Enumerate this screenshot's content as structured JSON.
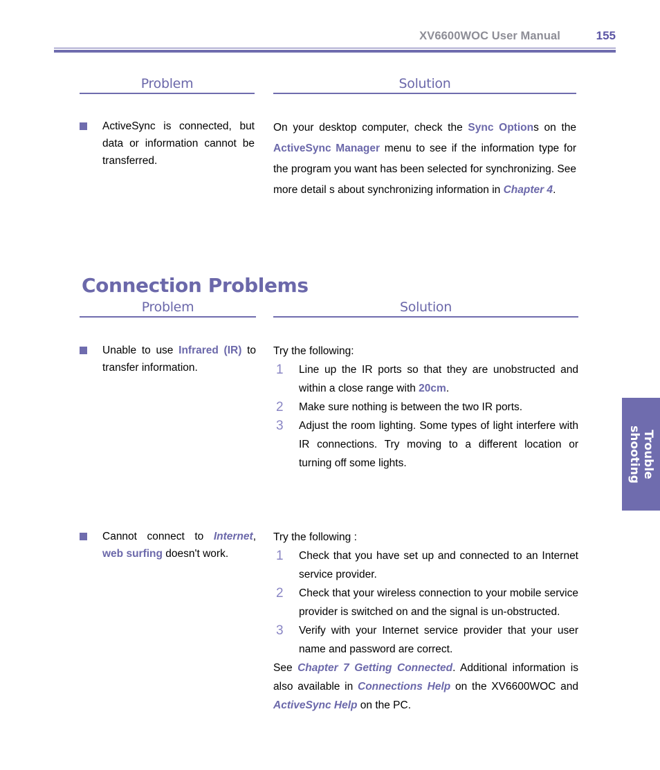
{
  "header": {
    "title": "XV6600WOC User Manual",
    "page_number": "155",
    "rule_color": "#6f6cae",
    "title_color": "#8d8d96",
    "page_number_color": "#5b55a4"
  },
  "accent_color": "#6b68aa",
  "table_headers": {
    "problem": "Problem",
    "solution": "Solution"
  },
  "section": {
    "heading": "Connection Problems"
  },
  "rows": [
    {
      "problem": {
        "pre": "ActiveSync is connected, but data or information cannot be transferred."
      },
      "solution": {
        "paragraph_parts": [
          {
            "type": "text",
            "value": "On your desktop computer, check the "
          },
          {
            "type": "bold",
            "value": "Sync Option"
          },
          {
            "type": "text",
            "value": "s  on the "
          },
          {
            "type": "bold",
            "value": "ActiveSync Manager"
          },
          {
            "type": "text",
            "value": " menu to see if the information type for the program you want has been selected for synchronizing. See more detail s about synchronizing information in "
          },
          {
            "type": "italic",
            "value": "Chapter 4"
          },
          {
            "type": "text",
            "value": "."
          }
        ]
      }
    },
    {
      "problem": {
        "parts": [
          {
            "type": "text",
            "value": "Unable to use "
          },
          {
            "type": "bold",
            "value": "Infrared (IR)"
          },
          {
            "type": "text",
            "value": " to transfer information."
          }
        ]
      },
      "solution": {
        "lead": "Try the following:",
        "items": [
          {
            "number": "1",
            "parts": [
              {
                "type": "text",
                "value": "Line up the IR ports so that they are unobstructed and within a close range with "
              },
              {
                "type": "bold",
                "value": "20cm"
              },
              {
                "type": "text",
                "value": "."
              }
            ]
          },
          {
            "number": "2",
            "parts": [
              {
                "type": "text",
                "value": "Make sure nothing is between the two IR ports."
              }
            ]
          },
          {
            "number": "3",
            "parts": [
              {
                "type": "text",
                "value": "Adjust the room lighting. Some types of light  interfere with IR connections. Try moving to a different location or  turning off some lights."
              }
            ]
          }
        ]
      }
    },
    {
      "problem": {
        "parts": [
          {
            "type": "text",
            "value": "Cannot connect to "
          },
          {
            "type": "italic",
            "value": "Internet"
          },
          {
            "type": "text",
            "value": ", "
          },
          {
            "type": "bold",
            "value": "web surfing"
          },
          {
            "type": "text",
            "value": " doesn't work."
          }
        ]
      },
      "solution": {
        "lead": "Try the following :",
        "items": [
          {
            "number": "1",
            "parts": [
              {
                "type": "text",
                "value": "Check that you have set up  and connected to an Internet service provider."
              }
            ]
          },
          {
            "number": "2",
            "parts": [
              {
                "type": "text",
                "value": "Check that your wireless connection to your mobile service provider is switched on and the signal  is un-obstructed."
              }
            ]
          },
          {
            "number": "3",
            "parts": [
              {
                "type": "text",
                "value": "Verify with your Internet service provider that your user name and password are correct."
              }
            ]
          }
        ],
        "trailing_parts": [
          {
            "type": "text",
            "value": "See "
          },
          {
            "type": "italic",
            "value": "Chapter 7 Getting Connected"
          },
          {
            "type": "text",
            "value": ".  Additional information is also available in "
          },
          {
            "type": "italic",
            "value": "Connections Help"
          },
          {
            "type": "text",
            "value": " on the XV6600WOC and "
          },
          {
            "type": "italic",
            "value": "ActiveSync Help"
          },
          {
            "type": "text",
            "value": " on the PC."
          }
        ]
      }
    }
  ],
  "side_tab": {
    "line1": "Trouble",
    "line2": "shooting",
    "background_color": "#6f6cae",
    "text_color": "#ffffff"
  }
}
